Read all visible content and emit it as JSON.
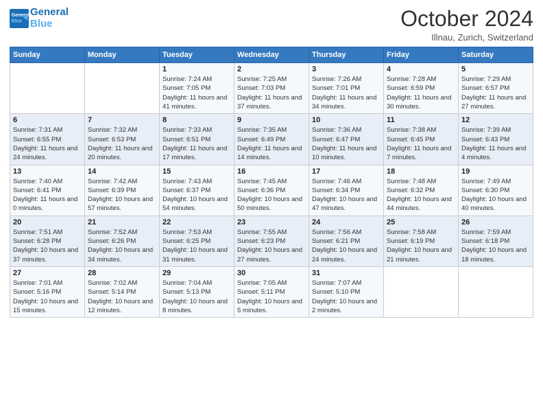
{
  "header": {
    "logo_line1": "General",
    "logo_line2": "Blue",
    "month": "October 2024",
    "location": "Illnau, Zurich, Switzerland"
  },
  "weekdays": [
    "Sunday",
    "Monday",
    "Tuesday",
    "Wednesday",
    "Thursday",
    "Friday",
    "Saturday"
  ],
  "weeks": [
    [
      {
        "day": null
      },
      {
        "day": null
      },
      {
        "day": "1",
        "sunrise": "Sunrise: 7:24 AM",
        "sunset": "Sunset: 7:05 PM",
        "daylight": "Daylight: 11 hours and 41 minutes."
      },
      {
        "day": "2",
        "sunrise": "Sunrise: 7:25 AM",
        "sunset": "Sunset: 7:03 PM",
        "daylight": "Daylight: 11 hours and 37 minutes."
      },
      {
        "day": "3",
        "sunrise": "Sunrise: 7:26 AM",
        "sunset": "Sunset: 7:01 PM",
        "daylight": "Daylight: 11 hours and 34 minutes."
      },
      {
        "day": "4",
        "sunrise": "Sunrise: 7:28 AM",
        "sunset": "Sunset: 6:59 PM",
        "daylight": "Daylight: 11 hours and 30 minutes."
      },
      {
        "day": "5",
        "sunrise": "Sunrise: 7:29 AM",
        "sunset": "Sunset: 6:57 PM",
        "daylight": "Daylight: 11 hours and 27 minutes."
      }
    ],
    [
      {
        "day": "6",
        "sunrise": "Sunrise: 7:31 AM",
        "sunset": "Sunset: 6:55 PM",
        "daylight": "Daylight: 11 hours and 24 minutes."
      },
      {
        "day": "7",
        "sunrise": "Sunrise: 7:32 AM",
        "sunset": "Sunset: 6:53 PM",
        "daylight": "Daylight: 11 hours and 20 minutes."
      },
      {
        "day": "8",
        "sunrise": "Sunrise: 7:33 AM",
        "sunset": "Sunset: 6:51 PM",
        "daylight": "Daylight: 11 hours and 17 minutes."
      },
      {
        "day": "9",
        "sunrise": "Sunrise: 7:35 AM",
        "sunset": "Sunset: 6:49 PM",
        "daylight": "Daylight: 11 hours and 14 minutes."
      },
      {
        "day": "10",
        "sunrise": "Sunrise: 7:36 AM",
        "sunset": "Sunset: 6:47 PM",
        "daylight": "Daylight: 11 hours and 10 minutes."
      },
      {
        "day": "11",
        "sunrise": "Sunrise: 7:38 AM",
        "sunset": "Sunset: 6:45 PM",
        "daylight": "Daylight: 11 hours and 7 minutes."
      },
      {
        "day": "12",
        "sunrise": "Sunrise: 7:39 AM",
        "sunset": "Sunset: 6:43 PM",
        "daylight": "Daylight: 11 hours and 4 minutes."
      }
    ],
    [
      {
        "day": "13",
        "sunrise": "Sunrise: 7:40 AM",
        "sunset": "Sunset: 6:41 PM",
        "daylight": "Daylight: 11 hours and 0 minutes."
      },
      {
        "day": "14",
        "sunrise": "Sunrise: 7:42 AM",
        "sunset": "Sunset: 6:39 PM",
        "daylight": "Daylight: 10 hours and 57 minutes."
      },
      {
        "day": "15",
        "sunrise": "Sunrise: 7:43 AM",
        "sunset": "Sunset: 6:37 PM",
        "daylight": "Daylight: 10 hours and 54 minutes."
      },
      {
        "day": "16",
        "sunrise": "Sunrise: 7:45 AM",
        "sunset": "Sunset: 6:36 PM",
        "daylight": "Daylight: 10 hours and 50 minutes."
      },
      {
        "day": "17",
        "sunrise": "Sunrise: 7:46 AM",
        "sunset": "Sunset: 6:34 PM",
        "daylight": "Daylight: 10 hours and 47 minutes."
      },
      {
        "day": "18",
        "sunrise": "Sunrise: 7:48 AM",
        "sunset": "Sunset: 6:32 PM",
        "daylight": "Daylight: 10 hours and 44 minutes."
      },
      {
        "day": "19",
        "sunrise": "Sunrise: 7:49 AM",
        "sunset": "Sunset: 6:30 PM",
        "daylight": "Daylight: 10 hours and 40 minutes."
      }
    ],
    [
      {
        "day": "20",
        "sunrise": "Sunrise: 7:51 AM",
        "sunset": "Sunset: 6:28 PM",
        "daylight": "Daylight: 10 hours and 37 minutes."
      },
      {
        "day": "21",
        "sunrise": "Sunrise: 7:52 AM",
        "sunset": "Sunset: 6:26 PM",
        "daylight": "Daylight: 10 hours and 34 minutes."
      },
      {
        "day": "22",
        "sunrise": "Sunrise: 7:53 AM",
        "sunset": "Sunset: 6:25 PM",
        "daylight": "Daylight: 10 hours and 31 minutes."
      },
      {
        "day": "23",
        "sunrise": "Sunrise: 7:55 AM",
        "sunset": "Sunset: 6:23 PM",
        "daylight": "Daylight: 10 hours and 27 minutes."
      },
      {
        "day": "24",
        "sunrise": "Sunrise: 7:56 AM",
        "sunset": "Sunset: 6:21 PM",
        "daylight": "Daylight: 10 hours and 24 minutes."
      },
      {
        "day": "25",
        "sunrise": "Sunrise: 7:58 AM",
        "sunset": "Sunset: 6:19 PM",
        "daylight": "Daylight: 10 hours and 21 minutes."
      },
      {
        "day": "26",
        "sunrise": "Sunrise: 7:59 AM",
        "sunset": "Sunset: 6:18 PM",
        "daylight": "Daylight: 10 hours and 18 minutes."
      }
    ],
    [
      {
        "day": "27",
        "sunrise": "Sunrise: 7:01 AM",
        "sunset": "Sunset: 5:16 PM",
        "daylight": "Daylight: 10 hours and 15 minutes."
      },
      {
        "day": "28",
        "sunrise": "Sunrise: 7:02 AM",
        "sunset": "Sunset: 5:14 PM",
        "daylight": "Daylight: 10 hours and 12 minutes."
      },
      {
        "day": "29",
        "sunrise": "Sunrise: 7:04 AM",
        "sunset": "Sunset: 5:13 PM",
        "daylight": "Daylight: 10 hours and 8 minutes."
      },
      {
        "day": "30",
        "sunrise": "Sunrise: 7:05 AM",
        "sunset": "Sunset: 5:11 PM",
        "daylight": "Daylight: 10 hours and 5 minutes."
      },
      {
        "day": "31",
        "sunrise": "Sunrise: 7:07 AM",
        "sunset": "Sunset: 5:10 PM",
        "daylight": "Daylight: 10 hours and 2 minutes."
      },
      {
        "day": null
      },
      {
        "day": null
      }
    ]
  ]
}
